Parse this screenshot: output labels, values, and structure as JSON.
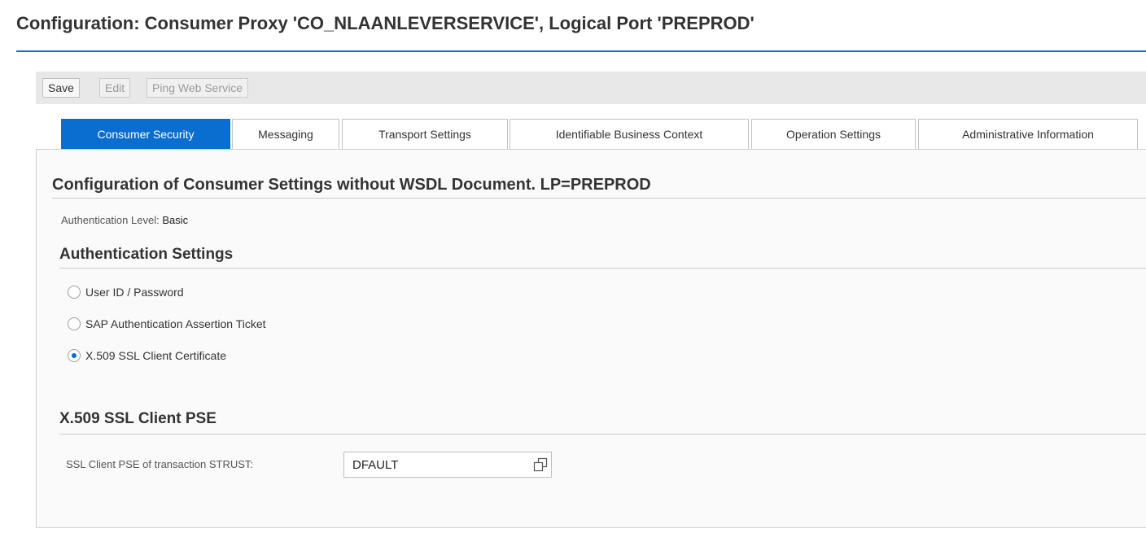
{
  "window": {
    "title": "Configuration: Consumer Proxy 'CO_NLAANLEVERSERVICE', Logical Port 'PREPROD'"
  },
  "toolbar": {
    "save_label": "Save",
    "edit_label": "Edit",
    "ping_label": "Ping Web Service"
  },
  "tabs": [
    {
      "label": "Consumer Security",
      "active": true
    },
    {
      "label": "Messaging",
      "active": false
    },
    {
      "label": "Transport Settings",
      "active": false
    },
    {
      "label": "Identifiable Business Context",
      "active": false
    },
    {
      "label": "Operation Settings",
      "active": false
    },
    {
      "label": "Administrative Information",
      "active": false
    }
  ],
  "main": {
    "heading": "Configuration of Consumer Settings without WSDL Document. LP=PREPROD",
    "auth_level_label": "Authentication Level:",
    "auth_level_value": "Basic",
    "auth_settings_heading": "Authentication Settings",
    "auth_options": [
      {
        "label": "User ID / Password",
        "selected": false
      },
      {
        "label": "SAP Authentication Assertion Ticket",
        "selected": false
      },
      {
        "label": "X.509 SSL Client Certificate",
        "selected": true
      }
    ],
    "pse_heading": "X.509 SSL Client PSE",
    "pse_field_label": "SSL Client PSE of transaction STRUST:",
    "pse_field_value": "DFAULT"
  },
  "icons": {
    "value_help": "value-help-icon"
  },
  "colors": {
    "accent": "#0a6ed1",
    "toolbar_bg": "#e8e8e8",
    "panel_bg": "#fafafa"
  }
}
